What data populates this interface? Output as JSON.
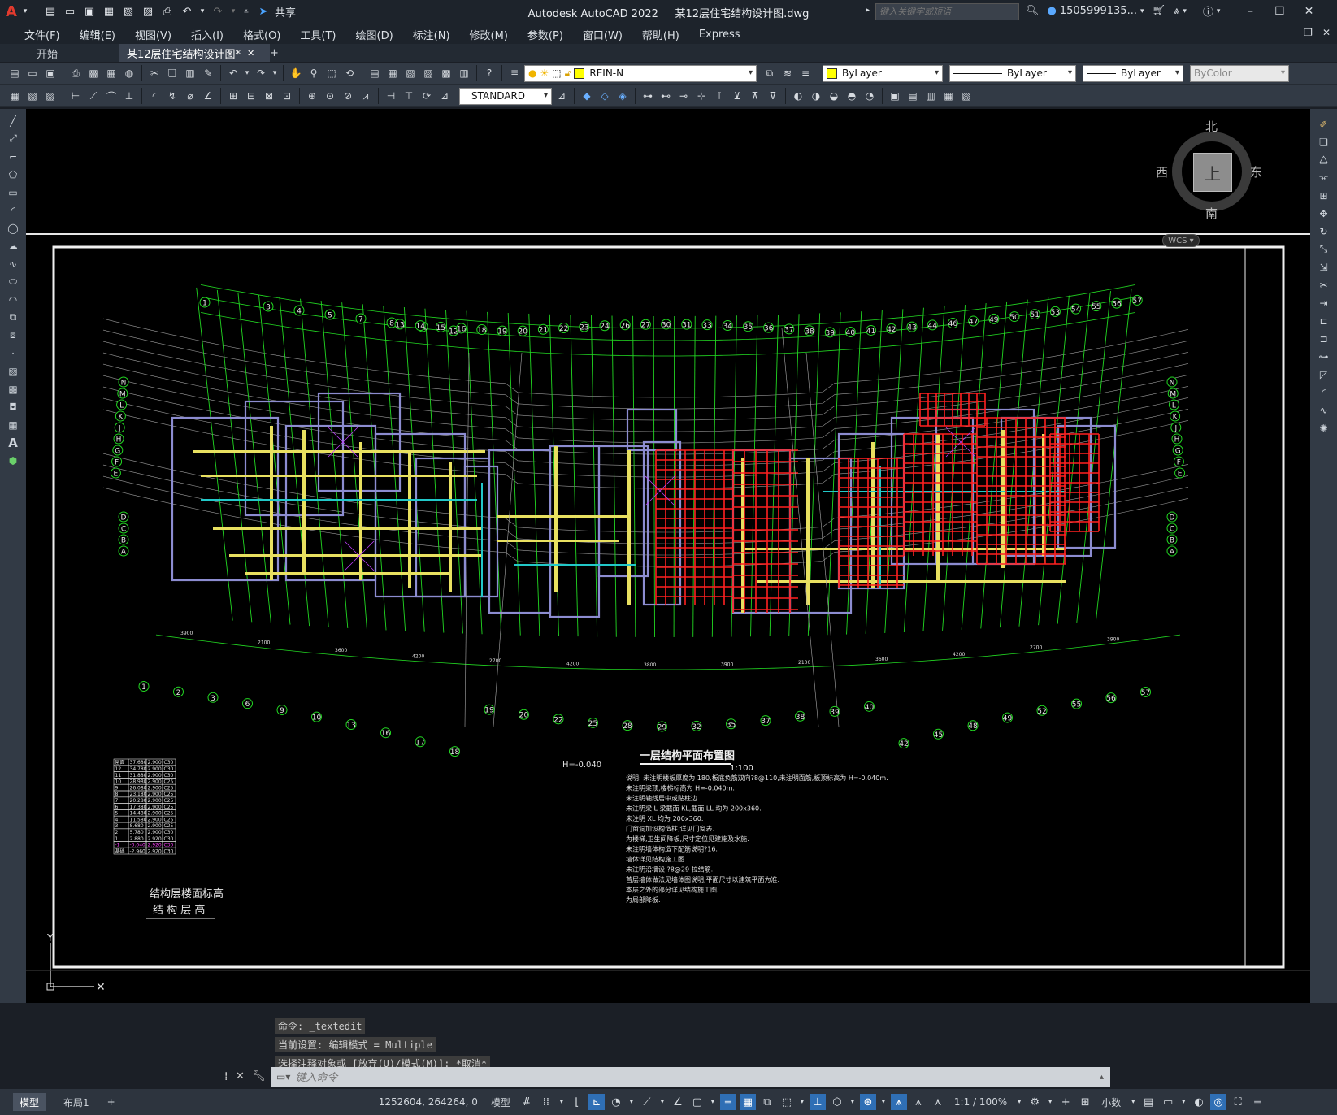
{
  "titlebar": {
    "app": "Autodesk AutoCAD 2022",
    "file": "某12层住宅结构设计图.dwg",
    "share": "共享",
    "search_placeholder": "键入关键字或短语",
    "user": "1505999135...",
    "logo": "A"
  },
  "menu": [
    "文件(F)",
    "编辑(E)",
    "视图(V)",
    "插入(I)",
    "格式(O)",
    "工具(T)",
    "绘图(D)",
    "标注(N)",
    "修改(M)",
    "参数(P)",
    "窗口(W)",
    "帮助(H)",
    "Express"
  ],
  "tabs": {
    "start": "开始",
    "doc": "某12层住宅结构设计图*"
  },
  "layer": {
    "name": "REIN-N",
    "color": "#ffff00"
  },
  "properties": {
    "color": "ByLayer",
    "linetype": "ByLayer",
    "lineweight": "ByLayer",
    "plotstyle": "ByColor"
  },
  "textstyle": "STANDARD",
  "viewcube": {
    "north": "北",
    "south": "南",
    "east": "东",
    "west": "西",
    "top": "上",
    "wcs": "WCS"
  },
  "drawing": {
    "title": "一层结构平面布置图",
    "scale": "1:100",
    "elev_label": "H=-0.040",
    "floor_table_title": "结构层楼面标高",
    "floor_table_subtitle": "结 构 层 高",
    "axis_top_row1": [
      "1",
      "3",
      "4",
      "5",
      "7",
      "8",
      "11",
      "12"
    ],
    "axis_top_row2": [
      "13",
      "14",
      "15",
      "16",
      "18",
      "19",
      "20",
      "21",
      "22",
      "23",
      "24",
      "26",
      "27",
      "30",
      "31",
      "33",
      "34",
      "35",
      "36",
      "37",
      "38",
      "39",
      "40",
      "41",
      "42",
      "43",
      "44",
      "46",
      "47",
      "49",
      "50",
      "51",
      "53",
      "54",
      "55",
      "56",
      "57"
    ],
    "axis_bottom": [
      "1",
      "2",
      "3",
      "6",
      "9",
      "10",
      "13",
      "16",
      "17",
      "18",
      "19",
      "20",
      "22",
      "25",
      "28",
      "29",
      "32",
      "35",
      "37",
      "38",
      "39",
      "40",
      "42",
      "45",
      "48",
      "49",
      "52",
      "55",
      "56",
      "57"
    ],
    "axis_left": [
      "N",
      "M",
      "L",
      "K",
      "J",
      "H",
      "G",
      "F",
      "E",
      "D",
      "C",
      "B",
      "A"
    ],
    "dims_bottom": [
      "3900",
      "2100",
      "3600",
      "4200",
      "2700",
      "4200",
      "3800",
      "3900",
      "2100",
      "3600",
      "4200",
      "2700",
      "3900"
    ],
    "notes": [
      "说明: 未注明楼板厚度为 180,板底负筋双向?8@110,未注明面筋,板顶标高为 H=-0.040m.",
      "未注明梁顶,楼梯标高为 H=-0.040m.",
      "未注明轴线居中或贴柱边.",
      "未注明梁 L 梁截面 KL,截面 LL 均为 200x360.",
      "未注明 XL 均为 200x360.",
      "门窗洞加设构造柱,详见门窗表.",
      "为楼梯,卫生间降板,尺寸定位见建施及水施.",
      "未注明墙体构造下配筋说明?16.",
      "墙体详见结构施工图.",
      "未注明沿墙设 ?8@29 拉结筋.",
      "首层墙体做法见墙体图说明,平面尺寸以建筑平面为准.",
      "本层之外的部分详见结构施工图.",
      "为局部降板."
    ],
    "floor_table": [
      [
        "屋面",
        "37.680",
        "2.900",
        "C30"
      ],
      [
        "12",
        "34.780",
        "2.900",
        "C30"
      ],
      [
        "11",
        "31.880",
        "2.900",
        "C30"
      ],
      [
        "10",
        "28.980",
        "2.900",
        "C25"
      ],
      [
        "9",
        "26.080",
        "2.900",
        "C25"
      ],
      [
        "8",
        "23.180",
        "2.900",
        "C25"
      ],
      [
        "7",
        "20.280",
        "2.900",
        "C25"
      ],
      [
        "6",
        "17.380",
        "2.900",
        "C25"
      ],
      [
        "5",
        "14.480",
        "2.900",
        "C25"
      ],
      [
        "4",
        "11.580",
        "2.900",
        "C25"
      ],
      [
        "3",
        "8.680",
        "2.900",
        "C25"
      ],
      [
        "2",
        "5.780",
        "2.900",
        "C30"
      ],
      [
        "1",
        "2.880",
        "2.920",
        "C30"
      ],
      [
        "-1",
        "-0.040",
        "2.920",
        "C30"
      ],
      [
        "基础",
        "-2.960",
        "2.920",
        "C30"
      ]
    ]
  },
  "command": {
    "history": [
      "命令: _textedit",
      "当前设置: 编辑模式 = Multiple",
      "选择注释对象或 [放弃(U)/模式(M)]: *取消*"
    ],
    "placeholder": "键入命令"
  },
  "status": {
    "model_tab": "模型",
    "layout_tab": "布局1",
    "coords": "1252604, 264264, 0",
    "space": "模型",
    "scale": "1:1 / 100%",
    "units": "小数"
  }
}
